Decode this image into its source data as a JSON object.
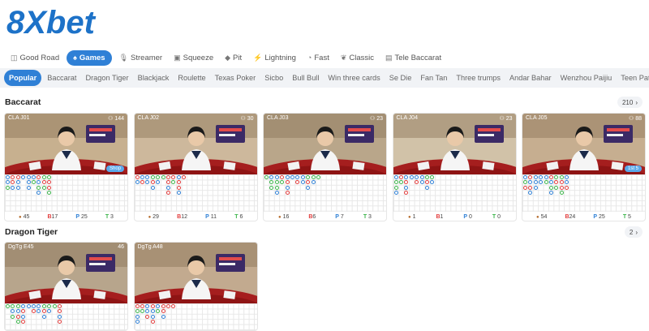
{
  "logo": {
    "text": "8Xbet"
  },
  "modes": [
    {
      "label": "Good Road",
      "icon": "road-icon",
      "active": false
    },
    {
      "label": "Games",
      "icon": "spade-icon",
      "active": true
    },
    {
      "label": "Streamer",
      "icon": "mic-icon",
      "active": false
    },
    {
      "label": "Squeeze",
      "icon": "squeeze-icon",
      "active": false
    },
    {
      "label": "Pit",
      "icon": "pit-icon",
      "active": false
    },
    {
      "label": "Lightning",
      "icon": "lightning-icon",
      "active": false
    },
    {
      "label": "Fast",
      "icon": "fast-icon",
      "active": false
    },
    {
      "label": "Classic",
      "icon": "classic-icon",
      "active": false
    },
    {
      "label": "Tele Baccarat",
      "icon": "tele-icon",
      "active": false
    }
  ],
  "categories": [
    "Popular",
    "Baccarat",
    "Dragon Tiger",
    "Blackjack",
    "Roulette",
    "Texas Poker",
    "Sicbo",
    "Bull Bull",
    "Win three cards",
    "Se Die",
    "Fan Tan",
    "Three trumps",
    "Andar Bahar",
    "Wenzhou Paijiu",
    "Teen Patti"
  ],
  "sections": {
    "baccarat": {
      "title": "Baccarat",
      "count": "210",
      "tables": [
        {
          "name": "CLA J01",
          "limit": "144",
          "badge": "Shop",
          "stats": {
            "d": "45",
            "b": "17",
            "p": "25",
            "t": "3"
          }
        },
        {
          "name": "CLA J02",
          "limit": "30",
          "badge": "",
          "stats": {
            "d": "29",
            "b": "12",
            "p": "11",
            "t": "6"
          }
        },
        {
          "name": "CLA J03",
          "limit": "23",
          "badge": "",
          "stats": {
            "d": "16",
            "b": "6",
            "p": "7",
            "t": "3"
          }
        },
        {
          "name": "CLA J04",
          "limit": "23",
          "badge": "",
          "stats": {
            "d": "1",
            "b": "1",
            "p": "0",
            "t": "0"
          }
        },
        {
          "name": "CLA J05",
          "limit": "88",
          "badge": "1st 5",
          "stats": {
            "d": "54",
            "b": "24",
            "p": "25",
            "t": "5"
          }
        }
      ]
    },
    "dragon_tiger": {
      "title": "Dragon Tiger",
      "count": "2",
      "tables": [
        {
          "name": "DgTg E45",
          "limit": "46"
        },
        {
          "name": "DgTg A48",
          "limit": ""
        }
      ]
    }
  },
  "colors": {
    "accent": "#2f80d6",
    "banker": "#e23c3c",
    "player": "#2f80d6",
    "tie": "#3bb54a"
  }
}
